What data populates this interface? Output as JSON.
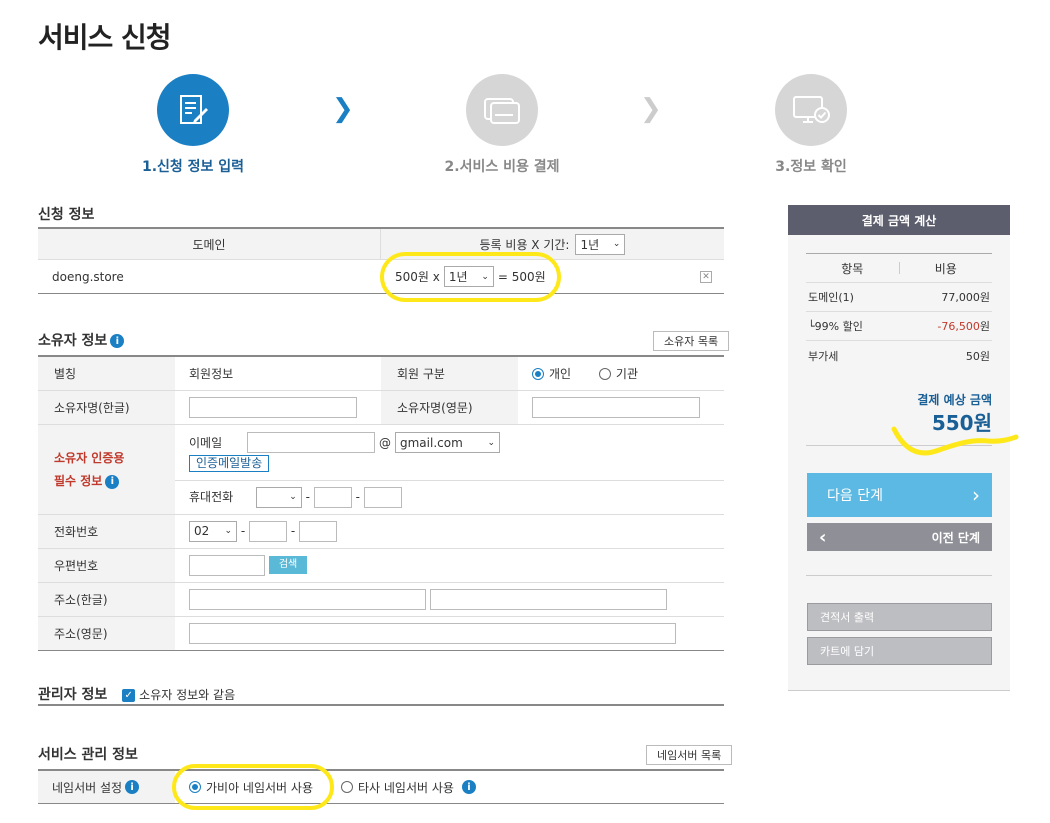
{
  "page_title": "서비스 신청",
  "steps": [
    {
      "label": "1.신청 정보 입력"
    },
    {
      "label": "2.서비스 비용 결제"
    },
    {
      "label": "3.정보 확인"
    }
  ],
  "application": {
    "title": "신청 정보",
    "col_domain": "도메인",
    "col_fee": "등록 비용 X 기간:",
    "period_header": "1년",
    "domain": "doeng.store",
    "unit_price": "500원 x",
    "period": "1년",
    "result": "= 500원"
  },
  "owner": {
    "title": "소유자 정보",
    "list_button": "소유자 목록",
    "alias_label": "별칭",
    "alias_value": "회원정보",
    "member_type_label": "회원 구분",
    "type_personal": "개인",
    "type_org": "기관",
    "name_kr_label": "소유자명(한글)",
    "name_en_label": "소유자명(영문)",
    "auth_label_line1": "소유자 인증용",
    "auth_label_line2": "필수 정보",
    "email_label": "이메일",
    "at": "@",
    "email_domain": "gmail.com",
    "send_mail": "인증메일발송",
    "mobile_label": "휴대전화",
    "dash": "-",
    "phone_label": "전화번호",
    "phone_prefix": "02",
    "zip_label": "우편번호",
    "search_button": "검색",
    "addr_kr_label": "주소(한글)",
    "addr_en_label": "주소(영문)"
  },
  "admin": {
    "title": "관리자 정보",
    "same_as_owner": "소유자 정보와 같음"
  },
  "service": {
    "title": "서비스 관리 정보",
    "ns_list_button": "네임서버 목록",
    "ns_label": "네임서버 설정",
    "ns_gabia": "가비아 네임서버 사용",
    "ns_other": "타사 네임서버 사용"
  },
  "payment": {
    "title": "결제 금액 계산",
    "col_item": "항목",
    "col_cost": "비용",
    "rows": [
      {
        "item": "도메인(1)",
        "cost": "77,000원"
      },
      {
        "item": "└99% 할인",
        "cost_red": "-76,500",
        "cost_unit": "원"
      },
      {
        "item": "부가세",
        "cost": "50원"
      }
    ],
    "total_label": "결제 예상 금액",
    "total_value": "550원",
    "next_button": "다음 단계",
    "next_arrow": "›",
    "prev_button": "이전 단계",
    "prev_arrow": "‹",
    "quote_button": "견적서 출력",
    "cart_button": "카트에 담기"
  },
  "colors": {
    "accent": "#1a7fc3",
    "highlight": "#ffe81a",
    "panel_header": "#5c5e6d"
  }
}
